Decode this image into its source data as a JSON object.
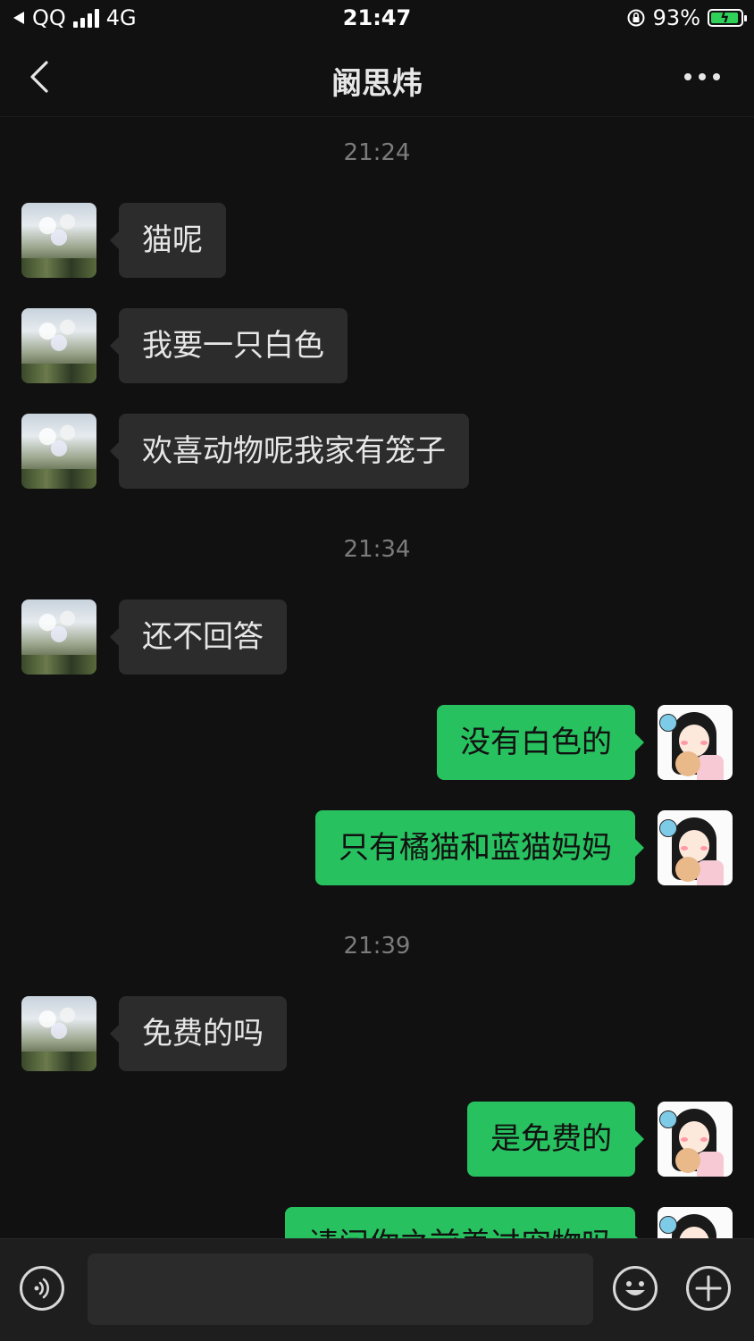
{
  "status_bar": {
    "carrier": "QQ",
    "network": "4G",
    "time": "21:47",
    "battery_percent": "93%",
    "battery_level": 0.93,
    "battery_color": "#2fd159"
  },
  "nav": {
    "title": "阚思炜",
    "back_icon": "chevron-left-icon",
    "more_icon": "more-dots-icon"
  },
  "chat": {
    "timestamps": [
      "21:24",
      "21:34",
      "21:39"
    ],
    "messages": [
      {
        "from": "peer",
        "text": "猫呢"
      },
      {
        "from": "peer",
        "text": "我要一只白色"
      },
      {
        "from": "peer",
        "text": "欢喜动物呢我家有笼子"
      },
      {
        "from": "peer",
        "text": "还不回答"
      },
      {
        "from": "me",
        "text": "没有白色的"
      },
      {
        "from": "me",
        "text": "只有橘猫和蓝猫妈妈"
      },
      {
        "from": "peer",
        "text": "免费的吗"
      },
      {
        "from": "me",
        "text": "是免费的"
      },
      {
        "from": "me",
        "text": "请问你之前养过宠物吗"
      }
    ],
    "my_bubble_color": "#28c15f",
    "peer_bubble_color": "#2c2c2c"
  },
  "input_bar": {
    "voice_icon": "voice-icon",
    "emoji_icon": "emoji-icon",
    "plus_icon": "plus-icon",
    "placeholder": ""
  }
}
